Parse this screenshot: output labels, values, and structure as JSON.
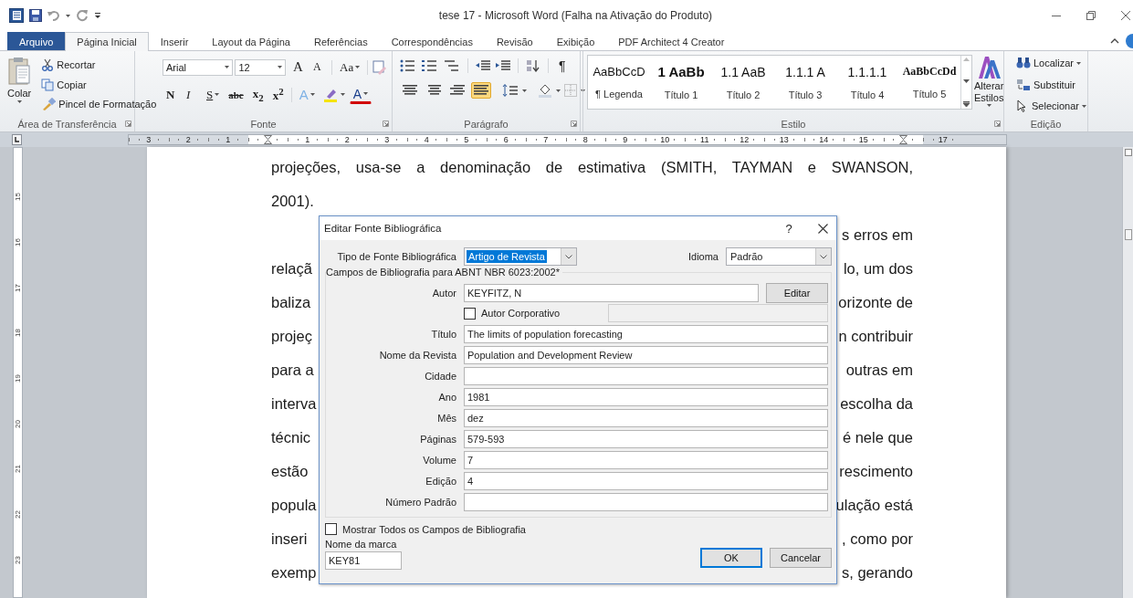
{
  "window": {
    "title": "tese 17 - Microsoft Word (Falha na Ativação do Produto)"
  },
  "tabs": [
    {
      "label": "Arquivo",
      "kind": "file",
      "selected": false
    },
    {
      "label": "Página Inicial",
      "kind": "tab",
      "selected": true
    },
    {
      "label": "Inserir",
      "kind": "tab",
      "selected": false
    },
    {
      "label": "Layout da Página",
      "kind": "tab",
      "selected": false
    },
    {
      "label": "Referências",
      "kind": "tab",
      "selected": false
    },
    {
      "label": "Correspondências",
      "kind": "tab",
      "selected": false
    },
    {
      "label": "Revisão",
      "kind": "tab",
      "selected": false
    },
    {
      "label": "Exibição",
      "kind": "tab",
      "selected": false
    },
    {
      "label": "PDF Architect 4 Creator",
      "kind": "tab",
      "selected": false
    }
  ],
  "ribbon": {
    "clipboard": {
      "title": "Área de Transferência",
      "paste": "Colar",
      "items": [
        {
          "label": "Recortar",
          "kind": "cut"
        },
        {
          "label": "Copiar",
          "kind": "copy"
        },
        {
          "label": "Pincel de Formatação",
          "kind": "painter"
        }
      ]
    },
    "font": {
      "title": "Fonte",
      "family": "Arial",
      "size": "12",
      "row1": [
        {
          "label": "A",
          "kind": "grow"
        },
        {
          "label": "A",
          "kind": "shrink"
        },
        {
          "label": "Aa",
          "kind": "case"
        },
        {
          "kind": "clear"
        }
      ],
      "row2": [
        {
          "label": "N",
          "kind": "bold"
        },
        {
          "label": "I",
          "kind": "italic"
        },
        {
          "label": "S",
          "kind": "underline"
        },
        {
          "label": "abc",
          "kind": "strike"
        },
        {
          "label": "x$_{2}$",
          "kind": "sub"
        },
        {
          "label": "x$^{2}$",
          "kind": "sup"
        },
        {
          "label": "A",
          "kind": "effects"
        },
        {
          "kind": "highlight"
        },
        {
          "label": "A",
          "kind": "color"
        }
      ]
    },
    "paragraph": {
      "title": "Parágrafo",
      "marks": "¶",
      "alignment": [
        {
          "selected": false
        },
        {
          "selected": false
        },
        {
          "selected": false
        },
        {
          "selected": true
        }
      ]
    },
    "styles": {
      "title": "Estilo",
      "change": "Alterar Estilos",
      "items": [
        {
          "preview": "AaBbCcD",
          "name": "¶ Legenda",
          "kind": "normal"
        },
        {
          "preview": "1 AaBb",
          "name": "Título 1",
          "kind": "h1"
        },
        {
          "preview": "1.1 AaB",
          "name": "Título 2",
          "kind": "h2"
        },
        {
          "preview": "1.1.1 A",
          "name": "Título 3",
          "kind": "h2"
        },
        {
          "preview": "1.1.1.1",
          "name": "Título 4",
          "kind": "h2"
        },
        {
          "preview": "AaBbCcDd",
          "name": "Título 5",
          "kind": "h5"
        }
      ]
    },
    "editing": {
      "title": "Edição",
      "items": [
        {
          "label": "Localizar",
          "kind": "find"
        },
        {
          "label": "Substituir",
          "kind": "replace"
        },
        {
          "label": "Selecionar",
          "kind": "select"
        }
      ]
    }
  },
  "ruler": {
    "horizontal": [
      {
        "label": "3",
        "kind": "margin"
      },
      {
        "label": "2",
        "kind": "margin"
      },
      {
        "label": "1",
        "kind": "margin"
      },
      {
        "kind": "indent"
      },
      {
        "label": "1",
        "kind": "number"
      },
      {
        "label": "2",
        "kind": "number"
      },
      {
        "label": "3",
        "kind": "number"
      },
      {
        "label": "4",
        "kind": "number"
      },
      {
        "label": "5",
        "kind": "number"
      },
      {
        "label": "6",
        "kind": "number"
      },
      {
        "label": "7",
        "kind": "number"
      },
      {
        "label": "8",
        "kind": "number"
      },
      {
        "label": "9",
        "kind": "number"
      },
      {
        "label": "10",
        "kind": "number"
      },
      {
        "label": "11",
        "kind": "number"
      },
      {
        "label": "12",
        "kind": "number"
      },
      {
        "label": "13",
        "kind": "number"
      },
      {
        "label": "14",
        "kind": "number"
      },
      {
        "label": "15",
        "kind": "number"
      },
      {
        "kind": "indent"
      },
      {
        "label": "17",
        "kind": "margin"
      }
    ],
    "vertical": [
      "15",
      "16",
      "17",
      "18",
      "19",
      "20",
      "21",
      "22",
      "23"
    ]
  },
  "document": {
    "lines": [
      {
        "kind": "full",
        "text": "projeções, usa-se a denominação de estimativa (SMITH, TAYMAN e SWANSON,"
      },
      {
        "kind": "start",
        "text": "2001)."
      },
      {
        "kind": "split",
        "right": "s erros em"
      },
      {
        "kind": "split",
        "left": "relaçã",
        "right": "lo, um dos"
      },
      {
        "kind": "split",
        "left": "baliza",
        "right": "orizonte de"
      },
      {
        "kind": "split",
        "left": "projeç",
        "right": "n contribuir"
      },
      {
        "kind": "split",
        "left": "para a",
        "right": "outras em"
      },
      {
        "kind": "split",
        "left": "interva",
        "right": "escolha da"
      },
      {
        "kind": "split",
        "left": "técnic",
        "right": "é nele que"
      },
      {
        "kind": "split",
        "left": "estão",
        "right": "rescimento"
      },
      {
        "kind": "split",
        "left": "popula",
        "right": "ulação está"
      },
      {
        "kind": "split",
        "left": "inseri",
        "right": ", como por"
      },
      {
        "kind": "split",
        "left": "exemp",
        "right": "s, gerando"
      }
    ]
  },
  "dialog": {
    "title": "Editar Fonte Bibliográfica",
    "help": "?",
    "source_type": {
      "label": "Tipo de Fonte Bibliográfica",
      "value": "Artigo de Revista"
    },
    "language": {
      "label": "Idioma",
      "value": "Padrão"
    },
    "group_title": "Campos de Bibliografia para ABNT NBR 6023:2002*",
    "author": {
      "label": "Autor",
      "value": "KEYFITZ, N",
      "button": "Editar"
    },
    "corporate": {
      "label": "Autor Corporativo",
      "checked": false
    },
    "fields": [
      {
        "label": "Título",
        "value": "The limits of population forecasting"
      },
      {
        "label": "Nome da Revista",
        "value": "Population and Development Review"
      },
      {
        "label": "Cidade"
      },
      {
        "label": "Ano",
        "value": "1981"
      },
      {
        "label": "Mês",
        "value": "dez"
      },
      {
        "label": "Páginas",
        "value": "579-593"
      },
      {
        "label": "Volume",
        "value": "7"
      },
      {
        "label": "Edição",
        "value": "4"
      },
      {
        "label": "Número Padrão"
      }
    ],
    "show_all": {
      "label": "Mostrar Todos os Campos de Bibliografia",
      "checked": false
    },
    "tag": {
      "label": "Nome da marca",
      "value": "KEY81"
    },
    "buttons": [
      {
        "label": "OK",
        "kind": "default"
      },
      {
        "label": "Cancelar",
        "kind": "normal"
      }
    ]
  }
}
